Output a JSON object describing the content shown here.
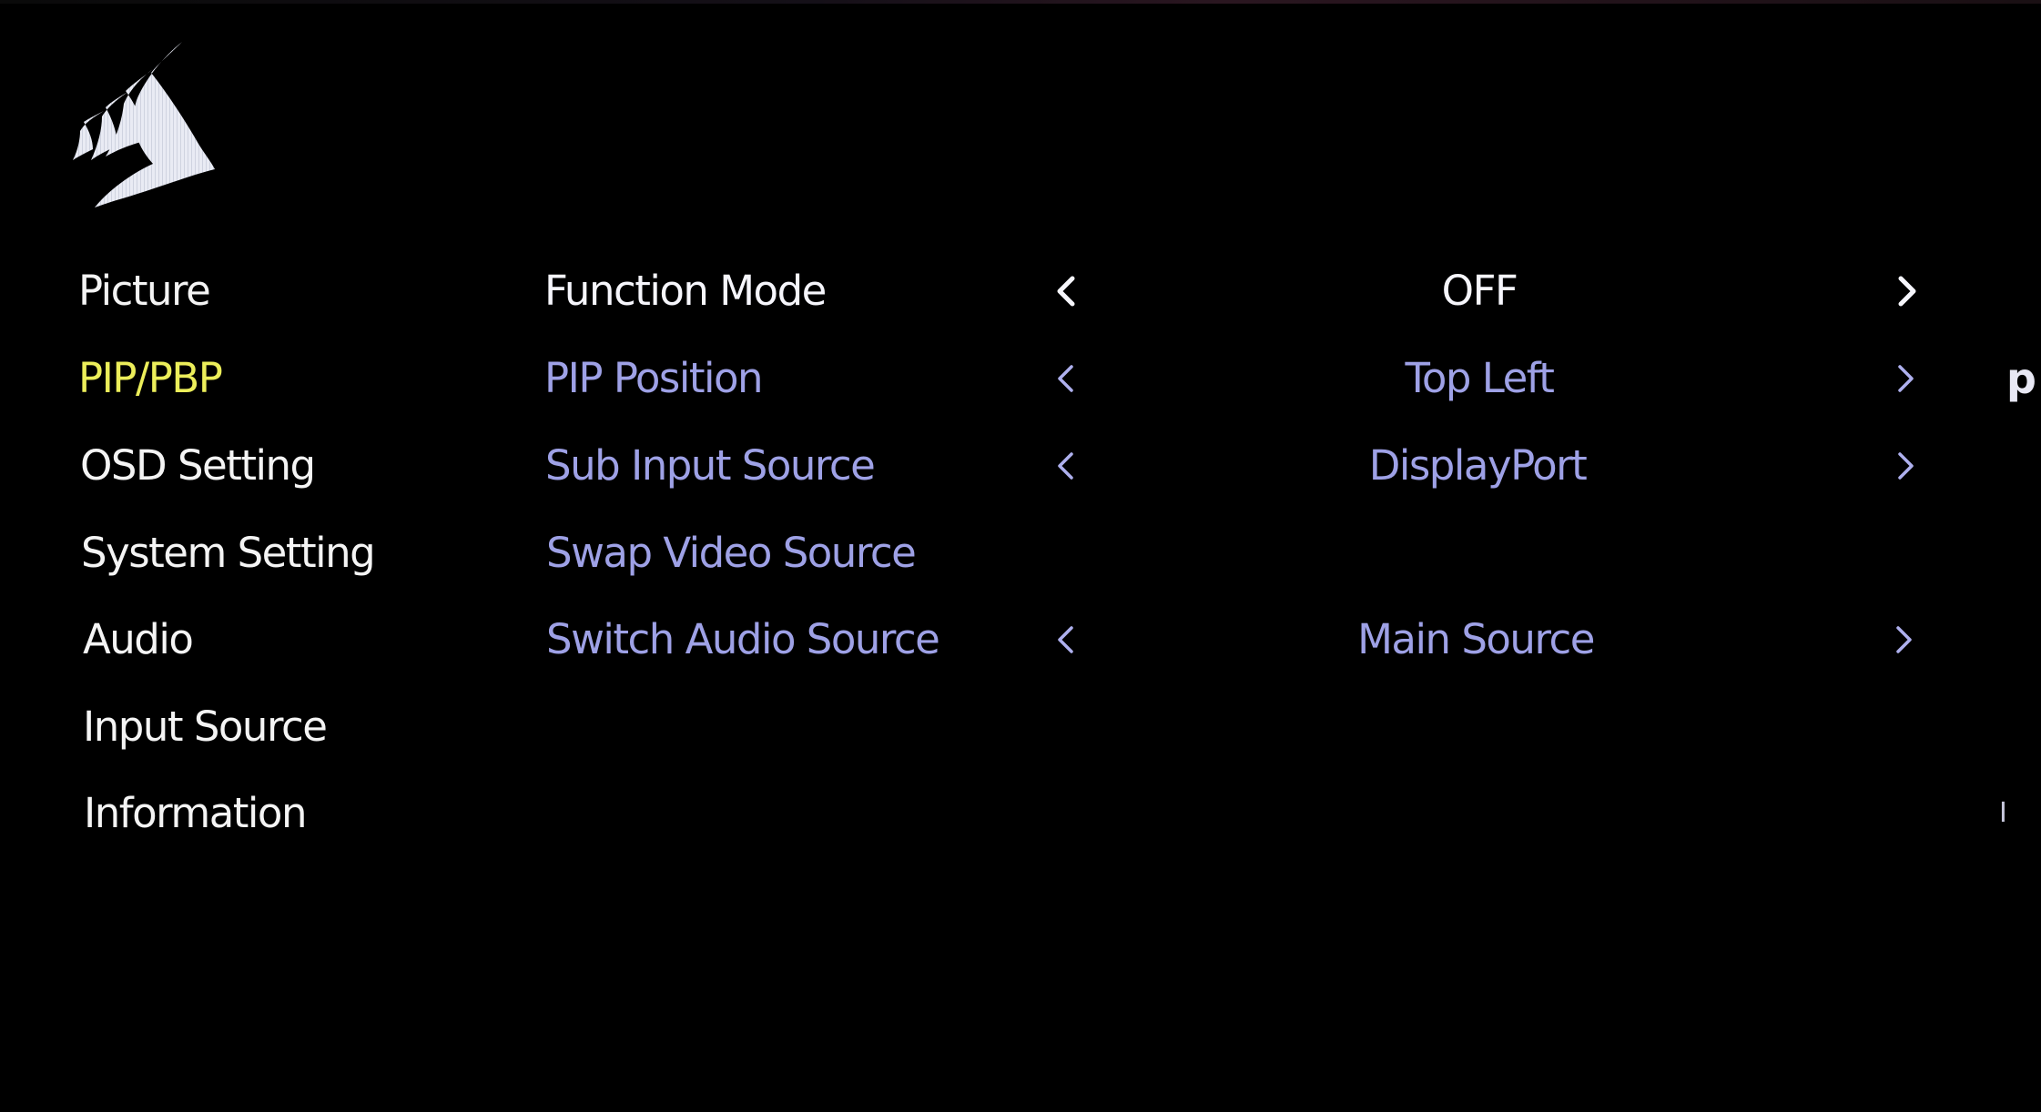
{
  "colors": {
    "background": "#000000",
    "menu_text": "#f4f4f4",
    "menu_active": "#ecee5a",
    "focused_row": "#f6f6fc",
    "row_text": "#9ea1e6",
    "arrow_focused": "#f6f6fc",
    "arrow_dim": "#aeb0ee"
  },
  "logo": {
    "icon": "corsair-sails-logo"
  },
  "menu": {
    "items": [
      {
        "label": "Picture",
        "active": false
      },
      {
        "label": "PIP/PBP",
        "active": true
      },
      {
        "label": "OSD Setting",
        "active": false
      },
      {
        "label": "System Setting",
        "active": false
      },
      {
        "label": "Audio",
        "active": false
      },
      {
        "label": "Input Source",
        "active": false
      },
      {
        "label": "Information",
        "active": false
      }
    ]
  },
  "settings": {
    "rows": [
      {
        "label": "Function Mode",
        "value": "OFF",
        "has_arrows": true,
        "focused": true
      },
      {
        "label": "PIP Position",
        "value": "Top Left",
        "has_arrows": true,
        "focused": false
      },
      {
        "label": "Sub Input Source",
        "value": "DisplayPort",
        "has_arrows": true,
        "focused": false
      },
      {
        "label": "Swap Video Source",
        "value": "",
        "has_arrows": false,
        "focused": false
      },
      {
        "label": "Switch Audio Source",
        "value": "Main Source",
        "has_arrows": true,
        "focused": false
      }
    ]
  },
  "edge": {
    "right_glyph_row2": "p",
    "right_glyph_row7": "I"
  }
}
